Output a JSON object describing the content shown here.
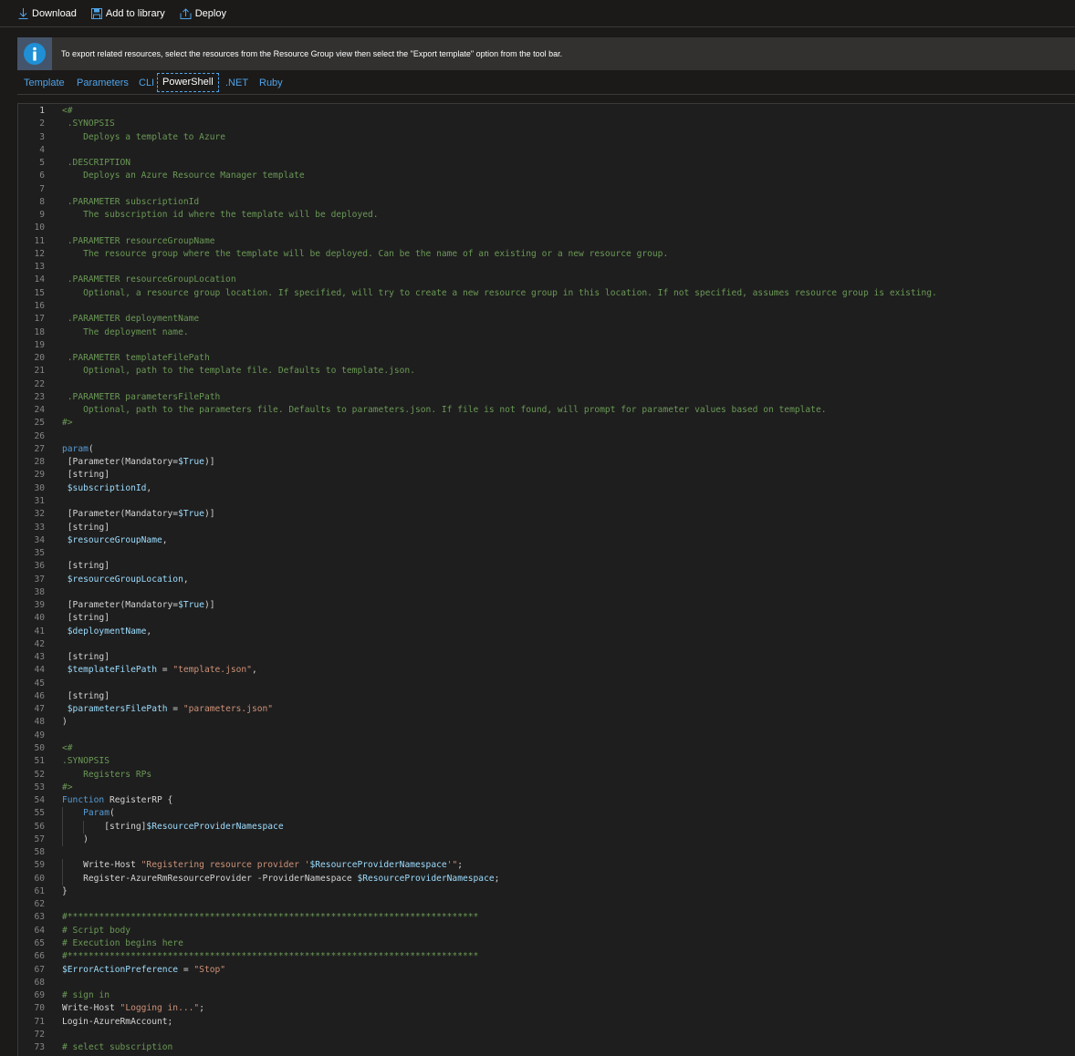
{
  "toolbar": {
    "download_label": "Download",
    "add_to_library_label": "Add to library",
    "deploy_label": "Deploy"
  },
  "info_bar": {
    "message": "To export related resources, select the resources from the Resource Group view then select the \"Export template\" option from the tool bar."
  },
  "tabs": [
    {
      "label": "Template",
      "active": false
    },
    {
      "label": "Parameters",
      "active": false
    },
    {
      "label": "CLI",
      "active": false
    },
    {
      "label": "PowerShell",
      "active": true
    },
    {
      "label": ".NET",
      "active": false
    },
    {
      "label": "Ruby",
      "active": false
    }
  ],
  "editor": {
    "current_line": 1,
    "lines": [
      {
        "n": 1,
        "text": "<#"
      },
      {
        "n": 2,
        "text": " .SYNOPSIS"
      },
      {
        "n": 3,
        "text": "    Deploys a template to Azure"
      },
      {
        "n": 4,
        "text": ""
      },
      {
        "n": 5,
        "text": " .DESCRIPTION"
      },
      {
        "n": 6,
        "text": "    Deploys an Azure Resource Manager template"
      },
      {
        "n": 7,
        "text": ""
      },
      {
        "n": 8,
        "text": " .PARAMETER subscriptionId"
      },
      {
        "n": 9,
        "text": "    The subscription id where the template will be deployed."
      },
      {
        "n": 10,
        "text": ""
      },
      {
        "n": 11,
        "text": " .PARAMETER resourceGroupName"
      },
      {
        "n": 12,
        "text": "    The resource group where the template will be deployed. Can be the name of an existing or a new resource group."
      },
      {
        "n": 13,
        "text": ""
      },
      {
        "n": 14,
        "text": " .PARAMETER resourceGroupLocation"
      },
      {
        "n": 15,
        "text": "    Optional, a resource group location. If specified, will try to create a new resource group in this location. If not specified, assumes resource group is existing."
      },
      {
        "n": 16,
        "text": ""
      },
      {
        "n": 17,
        "text": " .PARAMETER deploymentName"
      },
      {
        "n": 18,
        "text": "    The deployment name."
      },
      {
        "n": 19,
        "text": ""
      },
      {
        "n": 20,
        "text": " .PARAMETER templateFilePath"
      },
      {
        "n": 21,
        "text": "    Optional, path to the template file. Defaults to template.json."
      },
      {
        "n": 22,
        "text": ""
      },
      {
        "n": 23,
        "text": " .PARAMETER parametersFilePath"
      },
      {
        "n": 24,
        "text": "    Optional, path to the parameters file. Defaults to parameters.json. If file is not found, will prompt for parameter values based on template."
      },
      {
        "n": 25,
        "text": "#>"
      },
      {
        "n": 26,
        "text": ""
      },
      {
        "n": 27,
        "text": "param("
      },
      {
        "n": 28,
        "text": " [Parameter(Mandatory=$True)]"
      },
      {
        "n": 29,
        "text": " [string]"
      },
      {
        "n": 30,
        "text": " $subscriptionId,"
      },
      {
        "n": 31,
        "text": ""
      },
      {
        "n": 32,
        "text": " [Parameter(Mandatory=$True)]"
      },
      {
        "n": 33,
        "text": " [string]"
      },
      {
        "n": 34,
        "text": " $resourceGroupName,"
      },
      {
        "n": 35,
        "text": ""
      },
      {
        "n": 36,
        "text": " [string]"
      },
      {
        "n": 37,
        "text": " $resourceGroupLocation,"
      },
      {
        "n": 38,
        "text": ""
      },
      {
        "n": 39,
        "text": " [Parameter(Mandatory=$True)]"
      },
      {
        "n": 40,
        "text": " [string]"
      },
      {
        "n": 41,
        "text": " $deploymentName,"
      },
      {
        "n": 42,
        "text": ""
      },
      {
        "n": 43,
        "text": " [string]"
      },
      {
        "n": 44,
        "text": " $templateFilePath = \"template.json\","
      },
      {
        "n": 45,
        "text": ""
      },
      {
        "n": 46,
        "text": " [string]"
      },
      {
        "n": 47,
        "text": " $parametersFilePath = \"parameters.json\""
      },
      {
        "n": 48,
        "text": ")"
      },
      {
        "n": 49,
        "text": ""
      },
      {
        "n": 50,
        "text": "<#"
      },
      {
        "n": 51,
        "text": ".SYNOPSIS"
      },
      {
        "n": 52,
        "text": "    Registers RPs"
      },
      {
        "n": 53,
        "text": "#>"
      },
      {
        "n": 54,
        "text": "Function RegisterRP {"
      },
      {
        "n": 55,
        "text": "    Param("
      },
      {
        "n": 56,
        "text": "        [string]$ResourceProviderNamespace"
      },
      {
        "n": 57,
        "text": "    )"
      },
      {
        "n": 58,
        "text": ""
      },
      {
        "n": 59,
        "text": "    Write-Host \"Registering resource provider '$ResourceProviderNamespace'\";"
      },
      {
        "n": 60,
        "text": "    Register-AzureRmResourceProvider -ProviderNamespace $ResourceProviderNamespace;"
      },
      {
        "n": 61,
        "text": "}"
      },
      {
        "n": 62,
        "text": ""
      },
      {
        "n": 63,
        "text": "#******************************************************************************"
      },
      {
        "n": 64,
        "text": "# Script body"
      },
      {
        "n": 65,
        "text": "# Execution begins here"
      },
      {
        "n": 66,
        "text": "#******************************************************************************"
      },
      {
        "n": 67,
        "text": "$ErrorActionPreference = \"Stop\""
      },
      {
        "n": 68,
        "text": ""
      },
      {
        "n": 69,
        "text": "# sign in"
      },
      {
        "n": 70,
        "text": "Write-Host \"Logging in...\";"
      },
      {
        "n": 71,
        "text": "Login-AzureRmAccount;"
      },
      {
        "n": 72,
        "text": ""
      },
      {
        "n": 73,
        "text": "# select subscription"
      }
    ]
  }
}
